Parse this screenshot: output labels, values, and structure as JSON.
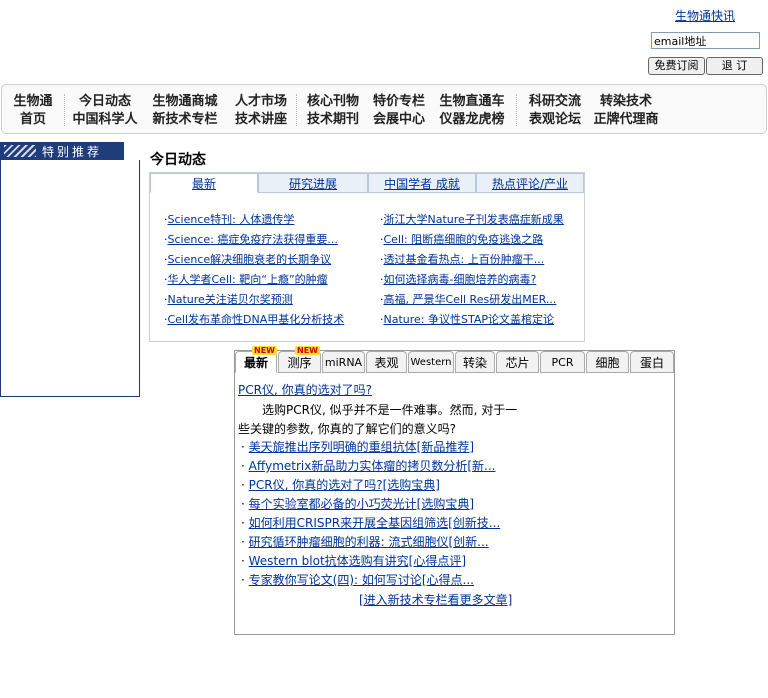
{
  "header": {
    "kuaixun": "生物通快讯",
    "email_value": "email地址",
    "subscribe_label": "免费订阅",
    "logout_label": "退 订"
  },
  "nav": [
    {
      "top": "生物通",
      "bottom": "首页"
    },
    {
      "top": "今日动态",
      "bottom": "中国科学人"
    },
    {
      "top": "生物通商城",
      "bottom": "新技术专栏"
    },
    {
      "top": "人才市场",
      "bottom": "技术讲座"
    },
    {
      "top": "核心刊物",
      "bottom": "技术期刊"
    },
    {
      "top": "特价专栏",
      "bottom": "会展中心"
    },
    {
      "top": "生物直通车",
      "bottom": "仪器龙虎榜"
    },
    {
      "top": "科研交流",
      "bottom": "表观论坛"
    },
    {
      "top": "转染技术",
      "bottom": "正牌代理商"
    }
  ],
  "sidebar": {
    "special_title": "特别推荐"
  },
  "today": {
    "title": "今日动态",
    "tabs": [
      "最新",
      "研究进展",
      "中国学者 成就",
      "热点评论/产业"
    ],
    "left_items": [
      "Science特刊: 人体遗传学",
      "Science: 癌症免疫疗法获得重要...",
      "Science解决细胞衰老的长期争议",
      "华人学者Cell: 靶向“上瘾”的肿瘤",
      "Nature关注诺贝尔奖预测",
      "Cell发布革命性DNA甲基化分析技术"
    ],
    "right_items": [
      "浙江大学Nature子刊发表癌症新成果",
      "Cell: 阻断癌细胞的免疫逃逸之路",
      "透过基金看热点: 上百份肿瘤干...",
      "如何选择病毒-细胞培养的病毒?",
      "高福, 严景华Cell Res研发出MER...",
      "Nature: 争议性STAP论文盖棺定论"
    ]
  },
  "categories": {
    "tabs": [
      "最新",
      "测序",
      "miRNA",
      "表观",
      "Western",
      "转染",
      "芯片",
      "PCR",
      "细胞",
      "蛋白"
    ],
    "new_badge": "NEW",
    "lead_title": "PCR仪, 你真的选对了吗?",
    "lead_text": "选购PCR仪, 似乎并不是一件难事。然而, 对于一些关键的参数, 你真的了解它们的意义吗?",
    "items": [
      "美天旎推出序列明确的重组抗体[新品推荐]",
      "Affymetrix新品助力实体瘤的拷贝数分析[新...",
      "PCR仪, 你真的选对了吗?[选购宝典]",
      "每个实验室都必备的小巧荧光计[选购宝典]",
      "如何利用CRISPR来开展全基因组筛选[创新技...",
      "研究循环肿瘤细胞的利器: 流式细胞仪[创新...",
      "Western blot抗体选购有讲究[心得点评]",
      "专家教你写论文(四): 如何写讨论[心得点..."
    ],
    "more_label": "[进入新技术专栏看更多文章]"
  },
  "colors": {
    "link": "#003399",
    "sidebar_head": "#1f3d7a"
  }
}
